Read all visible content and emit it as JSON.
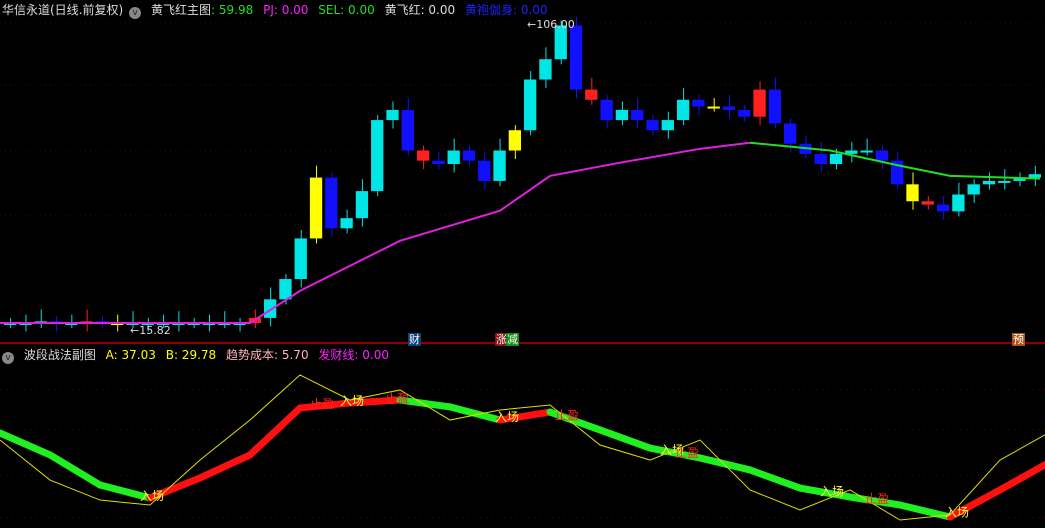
{
  "main_header": {
    "title": "华信永道(日线.前复权)",
    "indicator": "黄飞红主图",
    "value1": ": 59.98",
    "pj": "PJ: 0.00",
    "sel": "SEL: 0.00",
    "hfh": "黄飞红: 0.00",
    "hpjs": "黄袍伽身: 0.00"
  },
  "sub_header": {
    "title": "波段战法副图",
    "a": "A: 37.03",
    "b": "B: 29.78",
    "cost": "趋势成本: 5.70",
    "fcx": "发财线: 0.00"
  },
  "annotations": {
    "high": "106.00",
    "low": "15.82",
    "tag_cai": "财",
    "tag_zhang": "涨",
    "tag_jian": "减",
    "tag_yu": "预"
  },
  "signal_labels": {
    "entry": "入场",
    "take_profit": "止盈"
  },
  "colors": {
    "up": "#ff2020",
    "down": "#00e5e5",
    "blue": "#1010ff",
    "yellow": "#ffff00",
    "ma_magenta": "#e020e0",
    "ma_green": "#20e020"
  },
  "chart_data": [
    {
      "type": "candlestick",
      "title": "黄飞红主图",
      "ylim": [
        15.82,
        106.0
      ],
      "closes": [
        17,
        17,
        17.5,
        17,
        17,
        17.5,
        17,
        17,
        17,
        17,
        17,
        17,
        17,
        17,
        17,
        17,
        18.5,
        24,
        30,
        42,
        60,
        45,
        48,
        56,
        77,
        80,
        68,
        65,
        64,
        68,
        65,
        59,
        68,
        74,
        89,
        95,
        105,
        86,
        83,
        77,
        80,
        77,
        74,
        77,
        83,
        81,
        81,
        80,
        78,
        86,
        76,
        70,
        67,
        64,
        67,
        68,
        68,
        65,
        58,
        53,
        52,
        50,
        55,
        58,
        59,
        59,
        60,
        61
      ],
      "ma_line": [
        [
          0,
          17
        ],
        [
          250,
          17
        ],
        [
          300,
          26.5
        ],
        [
          400,
          41.3
        ],
        [
          500,
          50.2
        ],
        [
          550,
          60.5
        ],
        [
          620,
          64.4
        ],
        [
          700,
          68.5
        ],
        [
          750,
          70.3
        ],
        [
          830,
          68
        ],
        [
          900,
          63.5
        ],
        [
          950,
          60.5
        ],
        [
          1040,
          59.7
        ]
      ]
    },
    {
      "type": "line",
      "title": "波段战法副图",
      "ylim": [
        0,
        100
      ],
      "x": [
        0,
        50,
        100,
        150,
        200,
        250,
        300,
        350,
        400,
        450,
        500,
        550,
        600,
        650,
        700,
        750,
        800,
        850,
        900,
        950,
        1000,
        1050
      ],
      "series": [
        {
          "name": "A",
          "values": [
            57.5,
            43.8,
            25,
            16.9,
            29.4,
            43.8,
            73.1,
            76.3,
            78.1,
            73.8,
            65.6,
            70.6,
            59.4,
            48.1,
            41.9,
            34.4,
            23.1,
            17.5,
            12.5,
            5,
            21.9,
            39.4
          ]
        },
        {
          "name": "B",
          "values": [
            53.1,
            28.1,
            15.6,
            12.5,
            40.6,
            65.6,
            93.8,
            78.1,
            84.4,
            65.6,
            71.9,
            75,
            50,
            40.6,
            53.1,
            21.9,
            9.4,
            21.9,
            3.1,
            6.3,
            40.6,
            58.1
          ]
        }
      ],
      "signals": [
        {
          "x": 150,
          "label": "entry"
        },
        {
          "x": 320,
          "label": "take_profit"
        },
        {
          "x": 350,
          "label": "entry"
        },
        {
          "x": 395,
          "label": "take_profit"
        },
        {
          "x": 505,
          "label": "entry"
        },
        {
          "x": 565,
          "label": "take_profit"
        },
        {
          "x": 670,
          "label": "entry"
        },
        {
          "x": 685,
          "label": "take_profit"
        },
        {
          "x": 830,
          "label": "entry"
        },
        {
          "x": 875,
          "label": "take_profit"
        },
        {
          "x": 955,
          "label": "entry"
        }
      ]
    }
  ]
}
